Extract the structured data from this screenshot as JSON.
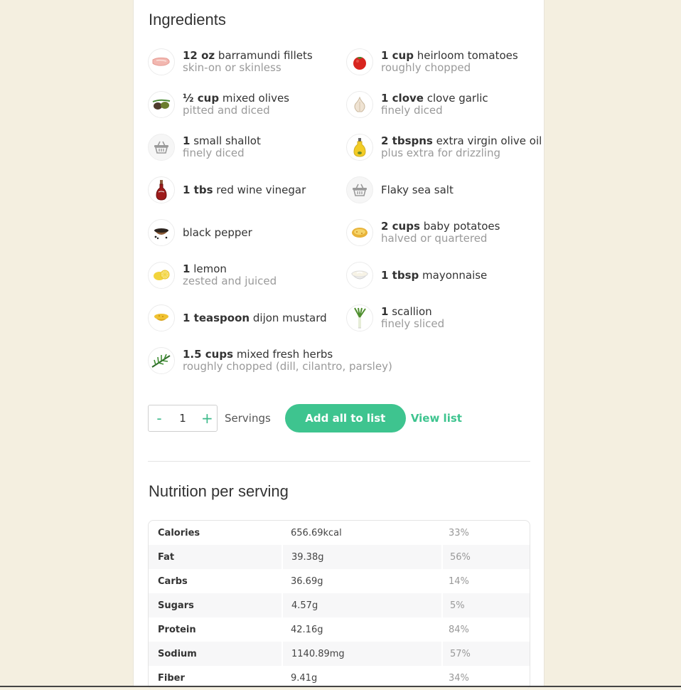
{
  "ingredients_title": "Ingredients",
  "ingredients": [
    {
      "qty": "12 oz",
      "name": "barramundi fillets",
      "note": "skin-on or skinless",
      "icon": "fish-fillet-icon"
    },
    {
      "qty": "1 cup",
      "name": "heirloom tomatoes",
      "note": "roughly chopped",
      "icon": "tomato-icon"
    },
    {
      "qty": "½ cup",
      "name": "mixed olives",
      "note": "pitted and diced",
      "icon": "olives-icon"
    },
    {
      "qty": "1 clove",
      "name": "clove garlic",
      "note": "finely diced",
      "icon": "garlic-icon"
    },
    {
      "qty": "1",
      "name": "small shallot",
      "note": "finely diced",
      "icon": "basket-icon"
    },
    {
      "qty": "2 tbspns",
      "name": "extra virgin olive oil",
      "note": "plus extra for drizzling",
      "icon": "olive-oil-icon"
    },
    {
      "qty": "1 tbs",
      "name": "red wine vinegar",
      "note": "",
      "icon": "vinegar-bottle-icon"
    },
    {
      "qty": "",
      "name": "Flaky sea salt",
      "note": "",
      "icon": "basket-icon"
    },
    {
      "qty": "",
      "name": "black pepper",
      "note": "",
      "icon": "pepper-bowl-icon"
    },
    {
      "qty": "2 cups",
      "name": "baby potatoes",
      "note": "halved or quartered",
      "icon": "potato-icon"
    },
    {
      "qty": "1",
      "name": "lemon",
      "note": "zested and juiced",
      "icon": "lemon-icon"
    },
    {
      "qty": "1 tbsp",
      "name": "mayonnaise",
      "note": "",
      "icon": "mayonnaise-icon"
    },
    {
      "qty": "1 teaspoon",
      "name": "dijon mustard",
      "note": "",
      "icon": "mustard-icon"
    },
    {
      "qty": "1",
      "name": "scallion",
      "note": "finely sliced",
      "icon": "scallion-icon"
    },
    {
      "qty": "1.5 cups",
      "name": "mixed fresh herbs",
      "note": "roughly chopped (dill, cilantro, parsley)",
      "icon": "herbs-icon"
    }
  ],
  "controls": {
    "minus": "-",
    "servings_value": "1",
    "plus": "+",
    "servings_label": "Servings",
    "add_all": "Add all to list",
    "view_list": "View list"
  },
  "nutrition_title": "Nutrition per serving",
  "nutrition": [
    {
      "label": "Calories",
      "value": "656.69kcal",
      "pct": "33%"
    },
    {
      "label": "Fat",
      "value": "39.38g",
      "pct": "56%"
    },
    {
      "label": "Carbs",
      "value": "36.69g",
      "pct": "14%"
    },
    {
      "label": "Sugars",
      "value": "4.57g",
      "pct": "5%"
    },
    {
      "label": "Protein",
      "value": "42.16g",
      "pct": "84%"
    },
    {
      "label": "Sodium",
      "value": "1140.89mg",
      "pct": "57%"
    },
    {
      "label": "Fiber",
      "value": "9.41g",
      "pct": "34%"
    }
  ],
  "colors": {
    "accent": "#3ec48f",
    "page_bg": "#f4efe0"
  }
}
